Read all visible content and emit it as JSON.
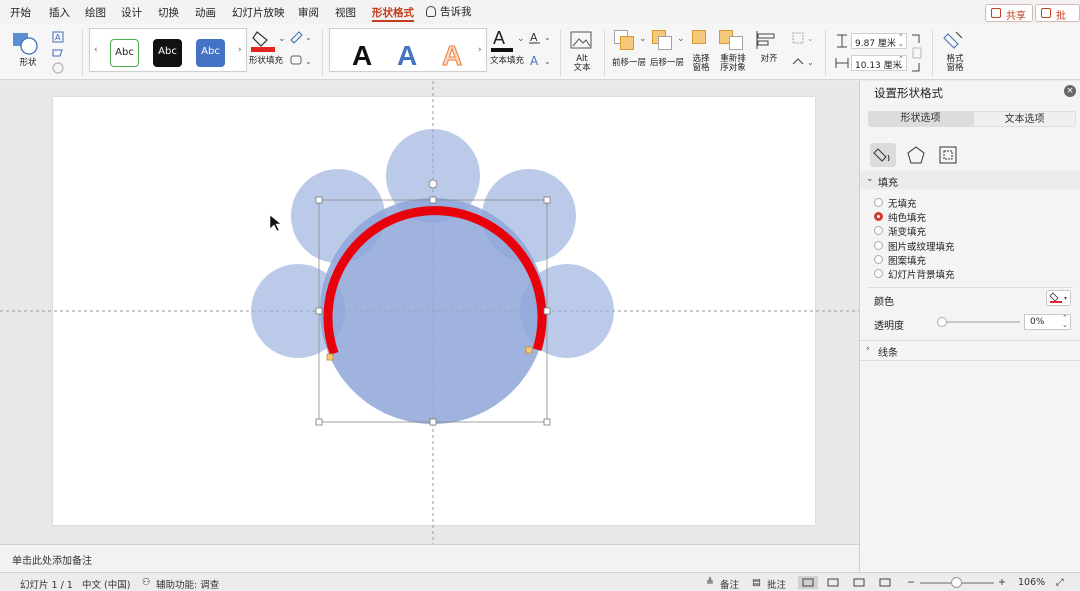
{
  "tabs": [
    "开始",
    "插入",
    "绘图",
    "设计",
    "切换",
    "动画",
    "幻灯片放映",
    "审阅",
    "视图",
    "形状格式"
  ],
  "active_tab": "形状格式",
  "tell_me": "告诉我",
  "share_button": "共享",
  "comment_button": "批注",
  "ribbon": {
    "shape_label": "形状",
    "style_abc": "Abc",
    "shape_fill_label": "形状填充",
    "wordart_letter": "A",
    "text_fill_label": "文本填充",
    "alt_text_line1": "Alt",
    "alt_text_line2": "文本",
    "bring_forward": "前移一层",
    "send_backward": "后移一层",
    "selection_pane_l1": "选择",
    "selection_pane_l2": "窗格",
    "reorder_l1": "重新排",
    "reorder_l2": "序对象",
    "align": "对齐",
    "height_value": "9.87 厘米",
    "width_value": "10.13 厘米",
    "format_pane_l1": "格式",
    "format_pane_l2": "窗格",
    "fill_color": "#e0261e"
  },
  "notes_placeholder": "单击此处添加备注",
  "pane": {
    "title": "设置形状格式",
    "tab_shape": "形状选项",
    "tab_text": "文本选项",
    "fill_section": "填充",
    "fill_options": [
      "无填充",
      "纯色填充",
      "渐变填充",
      "图片或纹理填充",
      "图案填充",
      "幻灯片背景填充"
    ],
    "selected_fill": "纯色填充",
    "color_label": "颜色",
    "transparency_label": "透明度",
    "transparency_value": "0%",
    "line_section": "线条"
  },
  "status": {
    "slide_info": "幻灯片 1 / 1",
    "language": "中文 (中国)",
    "accessibility": "辅助功能: 调查",
    "notes": "备注",
    "comments": "批注",
    "zoom": "106%"
  },
  "colors": {
    "accent": "#c43e1c",
    "circle_fill": "#8ea6d8",
    "arc_stroke": "#e8000b"
  }
}
